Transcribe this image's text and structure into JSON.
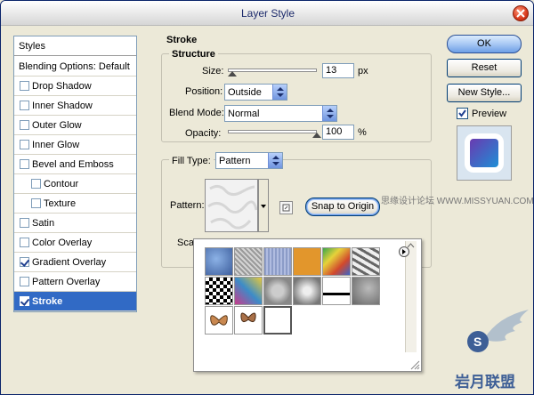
{
  "window": {
    "title": "Layer Style"
  },
  "styles_list": {
    "header": "Styles",
    "blending": "Blending Options: Default",
    "items": [
      {
        "label": "Drop Shadow",
        "checked": false,
        "indent": false,
        "selected": false
      },
      {
        "label": "Inner Shadow",
        "checked": false,
        "indent": false,
        "selected": false
      },
      {
        "label": "Outer Glow",
        "checked": false,
        "indent": false,
        "selected": false
      },
      {
        "label": "Inner Glow",
        "checked": false,
        "indent": false,
        "selected": false
      },
      {
        "label": "Bevel and Emboss",
        "checked": false,
        "indent": false,
        "selected": false
      },
      {
        "label": "Contour",
        "checked": false,
        "indent": true,
        "selected": false
      },
      {
        "label": "Texture",
        "checked": false,
        "indent": true,
        "selected": false
      },
      {
        "label": "Satin",
        "checked": false,
        "indent": false,
        "selected": false
      },
      {
        "label": "Color Overlay",
        "checked": false,
        "indent": false,
        "selected": false
      },
      {
        "label": "Gradient Overlay",
        "checked": true,
        "indent": false,
        "selected": false
      },
      {
        "label": "Pattern Overlay",
        "checked": false,
        "indent": false,
        "selected": false
      },
      {
        "label": "Stroke",
        "checked": true,
        "indent": false,
        "selected": true
      }
    ]
  },
  "stroke": {
    "title": "Stroke",
    "structure_title": "Structure",
    "size_label": "Size:",
    "size_value": "13",
    "size_unit": "px",
    "size_fraction": 0.05,
    "position_label": "Position:",
    "position_value": "Outside",
    "blend_label": "Blend Mode:",
    "blend_value": "Normal",
    "opacity_label": "Opacity:",
    "opacity_value": "100",
    "opacity_unit": "%",
    "opacity_fraction": 1.0,
    "fill_type_label": "Fill Type:",
    "fill_type_value": "Pattern",
    "pattern_label": "Pattern:",
    "snap_button": "Snap to Origin",
    "scale_label": "Sca"
  },
  "buttons": {
    "ok": "OK",
    "reset": "Reset",
    "new_style": "New Style...",
    "preview_label": "Preview",
    "preview_checked": true
  },
  "watermark": {
    "site_text": "思缘设计论坛 WWW.MISSYUAN.COM",
    "logo_text": "岩月联盟"
  },
  "colors": {
    "selection": "#316ac5",
    "title_text": "#1c2a6b"
  }
}
